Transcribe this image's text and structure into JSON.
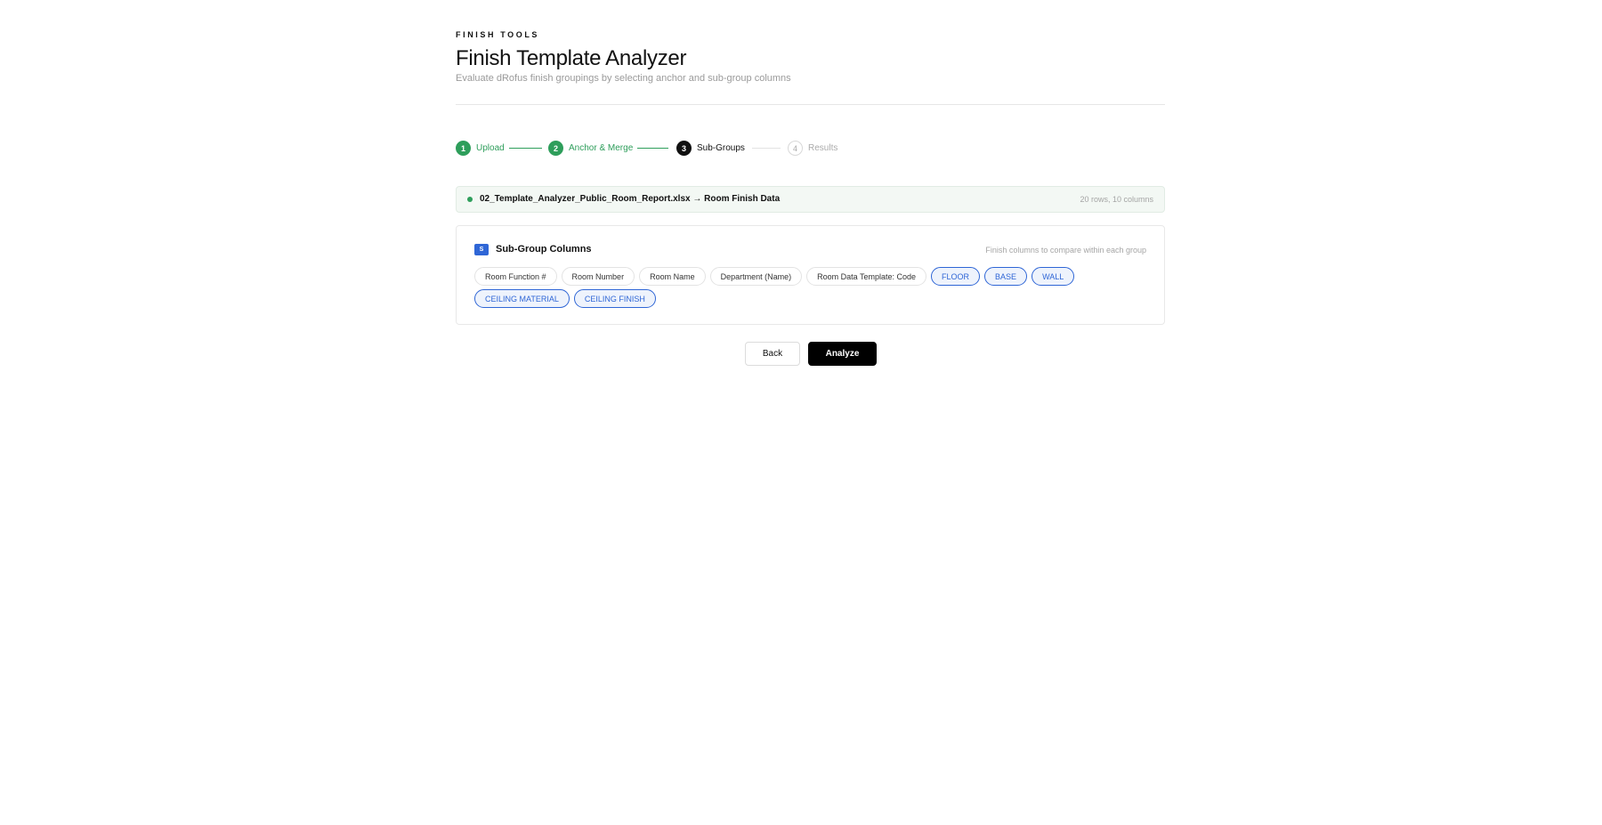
{
  "header": {
    "eyebrow": "FINISH TOOLS",
    "title": "Finish Template Analyzer",
    "subtitle": "Evaluate dRofus finish groupings by selecting anchor and sub-group columns"
  },
  "stepper": {
    "steps": [
      {
        "number": "1",
        "label": "Upload",
        "state": "done"
      },
      {
        "number": "2",
        "label": "Anchor & Merge",
        "state": "done"
      },
      {
        "number": "3",
        "label": "Sub-Groups",
        "state": "active"
      },
      {
        "number": "4",
        "label": "Results",
        "state": "todo"
      }
    ]
  },
  "file_banner": {
    "name": "02_Template_Analyzer_Public_Room_Report.xlsx → Room Finish Data",
    "meta": "20 rows, 10 columns"
  },
  "subgroup_card": {
    "badge": "S",
    "title": "Sub-Group Columns",
    "hint": "Finish columns to compare within each group",
    "columns": [
      {
        "label": "Room Function #",
        "selected": false
      },
      {
        "label": "Room Number",
        "selected": false
      },
      {
        "label": "Room Name",
        "selected": false
      },
      {
        "label": "Department (Name)",
        "selected": false
      },
      {
        "label": "Room Data Template: Code",
        "selected": false
      },
      {
        "label": "FLOOR",
        "selected": true
      },
      {
        "label": "BASE",
        "selected": true
      },
      {
        "label": "WALL",
        "selected": true
      },
      {
        "label": "CEILING MATERIAL",
        "selected": true
      },
      {
        "label": "CEILING FINISH",
        "selected": true
      }
    ]
  },
  "actions": {
    "back_label": "Back",
    "analyze_label": "Analyze"
  },
  "colors": {
    "done": "#2e9e5b",
    "active": "#111111",
    "accent": "#2f66d6",
    "primary_button": "#000000"
  }
}
